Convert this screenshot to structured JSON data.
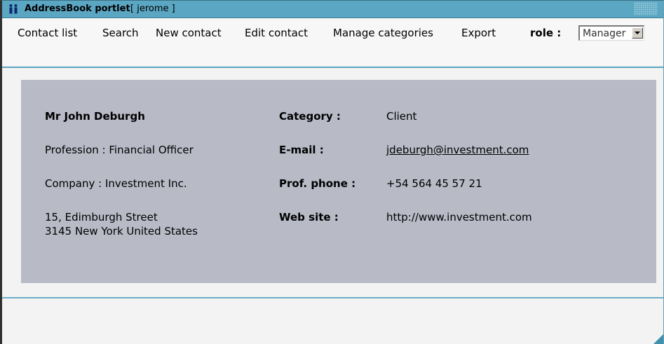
{
  "titlebar": {
    "icon": "people-icon",
    "title": "AddressBook portlet",
    "user": "[ jerome ]"
  },
  "menu": {
    "items": [
      "Contact list",
      "Search",
      "New contact",
      "Edit contact",
      "Manage categories",
      "Export"
    ],
    "role_label": "role :",
    "role_value": "Manager"
  },
  "contact": {
    "name": "Mr John  Deburgh",
    "profession": "Profession : Financial Officer",
    "company": "Company : Investment Inc.",
    "address_line1": "15, Edimburgh Street",
    "address_line2": "3145  New York  United States",
    "category_label": "Category :",
    "category_value": "Client",
    "email_label": "E-mail :",
    "email_value": "jdeburgh@investment.com",
    "phone_label": "Prof. phone :",
    "phone_value": "+54 564 45 57 21",
    "website_label": "Web site :",
    "website_value": "http://www.investment.com"
  },
  "colors": {
    "titlebar": "#5ba6c2",
    "panel": "#b8bac6",
    "accent_line": "#5ba6c2"
  }
}
